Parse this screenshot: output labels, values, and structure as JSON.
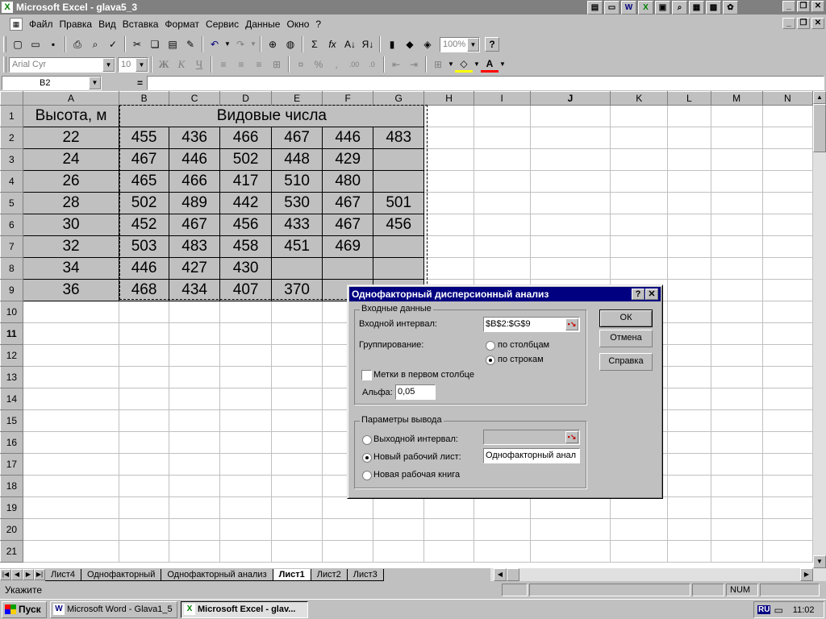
{
  "window": {
    "title": "Microsoft Excel - glava5_3"
  },
  "menu": [
    "Файл",
    "Правка",
    "Вид",
    "Вставка",
    "Формат",
    "Сервис",
    "Данные",
    "Окно",
    "?"
  ],
  "toolbar": {
    "zoom": "100%",
    "font_name": "Arial Cyr",
    "font_size": "10",
    "bold": "Ж",
    "italic": "К",
    "underline": "Ч"
  },
  "formula_bar": {
    "name_box": "B2",
    "equals": "=",
    "content": ""
  },
  "sheet": {
    "columns": [
      "A",
      "B",
      "C",
      "D",
      "E",
      "F",
      "G",
      "H",
      "I",
      "J",
      "K",
      "L",
      "M",
      "N"
    ],
    "active_column": "J",
    "active_row": "11",
    "header_a1": "Высота, м",
    "header_b1": "Видовые числа",
    "rows": [
      [
        "22",
        "455",
        "436",
        "466",
        "467",
        "446",
        "483"
      ],
      [
        "24",
        "467",
        "446",
        "502",
        "448",
        "429",
        ""
      ],
      [
        "26",
        "465",
        "466",
        "417",
        "510",
        "480",
        ""
      ],
      [
        "28",
        "502",
        "489",
        "442",
        "530",
        "467",
        "501"
      ],
      [
        "30",
        "452",
        "467",
        "456",
        "433",
        "467",
        "456"
      ],
      [
        "32",
        "503",
        "483",
        "458",
        "451",
        "469",
        ""
      ],
      [
        "34",
        "446",
        "427",
        "430",
        "",
        "",
        ""
      ],
      [
        "36",
        "468",
        "434",
        "407",
        "370",
        "",
        ""
      ]
    ],
    "row_numbers": [
      "1",
      "2",
      "3",
      "4",
      "5",
      "6",
      "7",
      "8",
      "9",
      "10",
      "11",
      "12",
      "13",
      "14",
      "15",
      "16",
      "17",
      "18",
      "19",
      "20",
      "21"
    ]
  },
  "tabs": [
    "Лист4",
    "Однофакторный",
    "Однофакторный анализ",
    "Лист1",
    "Лист2",
    "Лист3"
  ],
  "active_tab": "Лист1",
  "status": {
    "text": "Укажите",
    "num": "NUM"
  },
  "taskbar": {
    "start": "Пуск",
    "items": [
      "Microsoft Word - Glava1_5",
      "Microsoft Excel - glav..."
    ],
    "lang": "RU",
    "clock": "11:02"
  },
  "dialog": {
    "title": "Однофакторный дисперсионный анализ",
    "input_group": "Входные данные",
    "input_range_label": "Входной интервал:",
    "input_range_value": "$B$2:$G$9",
    "grouping_label": "Группирование:",
    "grouping_columns": "по столбцам",
    "grouping_rows": "по строкам",
    "grouping_selected": "rows",
    "labels_checkbox": "Метки в первом столбце",
    "labels_checked": false,
    "alpha_label": "Альфа:",
    "alpha_value": "0,05",
    "output_group": "Параметры вывода",
    "output_range_label": "Выходной интервал:",
    "new_sheet_label": "Новый рабочий лист:",
    "new_sheet_value": "Однофакторный анал",
    "new_book_label": "Новая рабочая книга",
    "output_selected": "new_sheet",
    "ok": "ОК",
    "cancel": "Отмена",
    "help": "Справка"
  }
}
